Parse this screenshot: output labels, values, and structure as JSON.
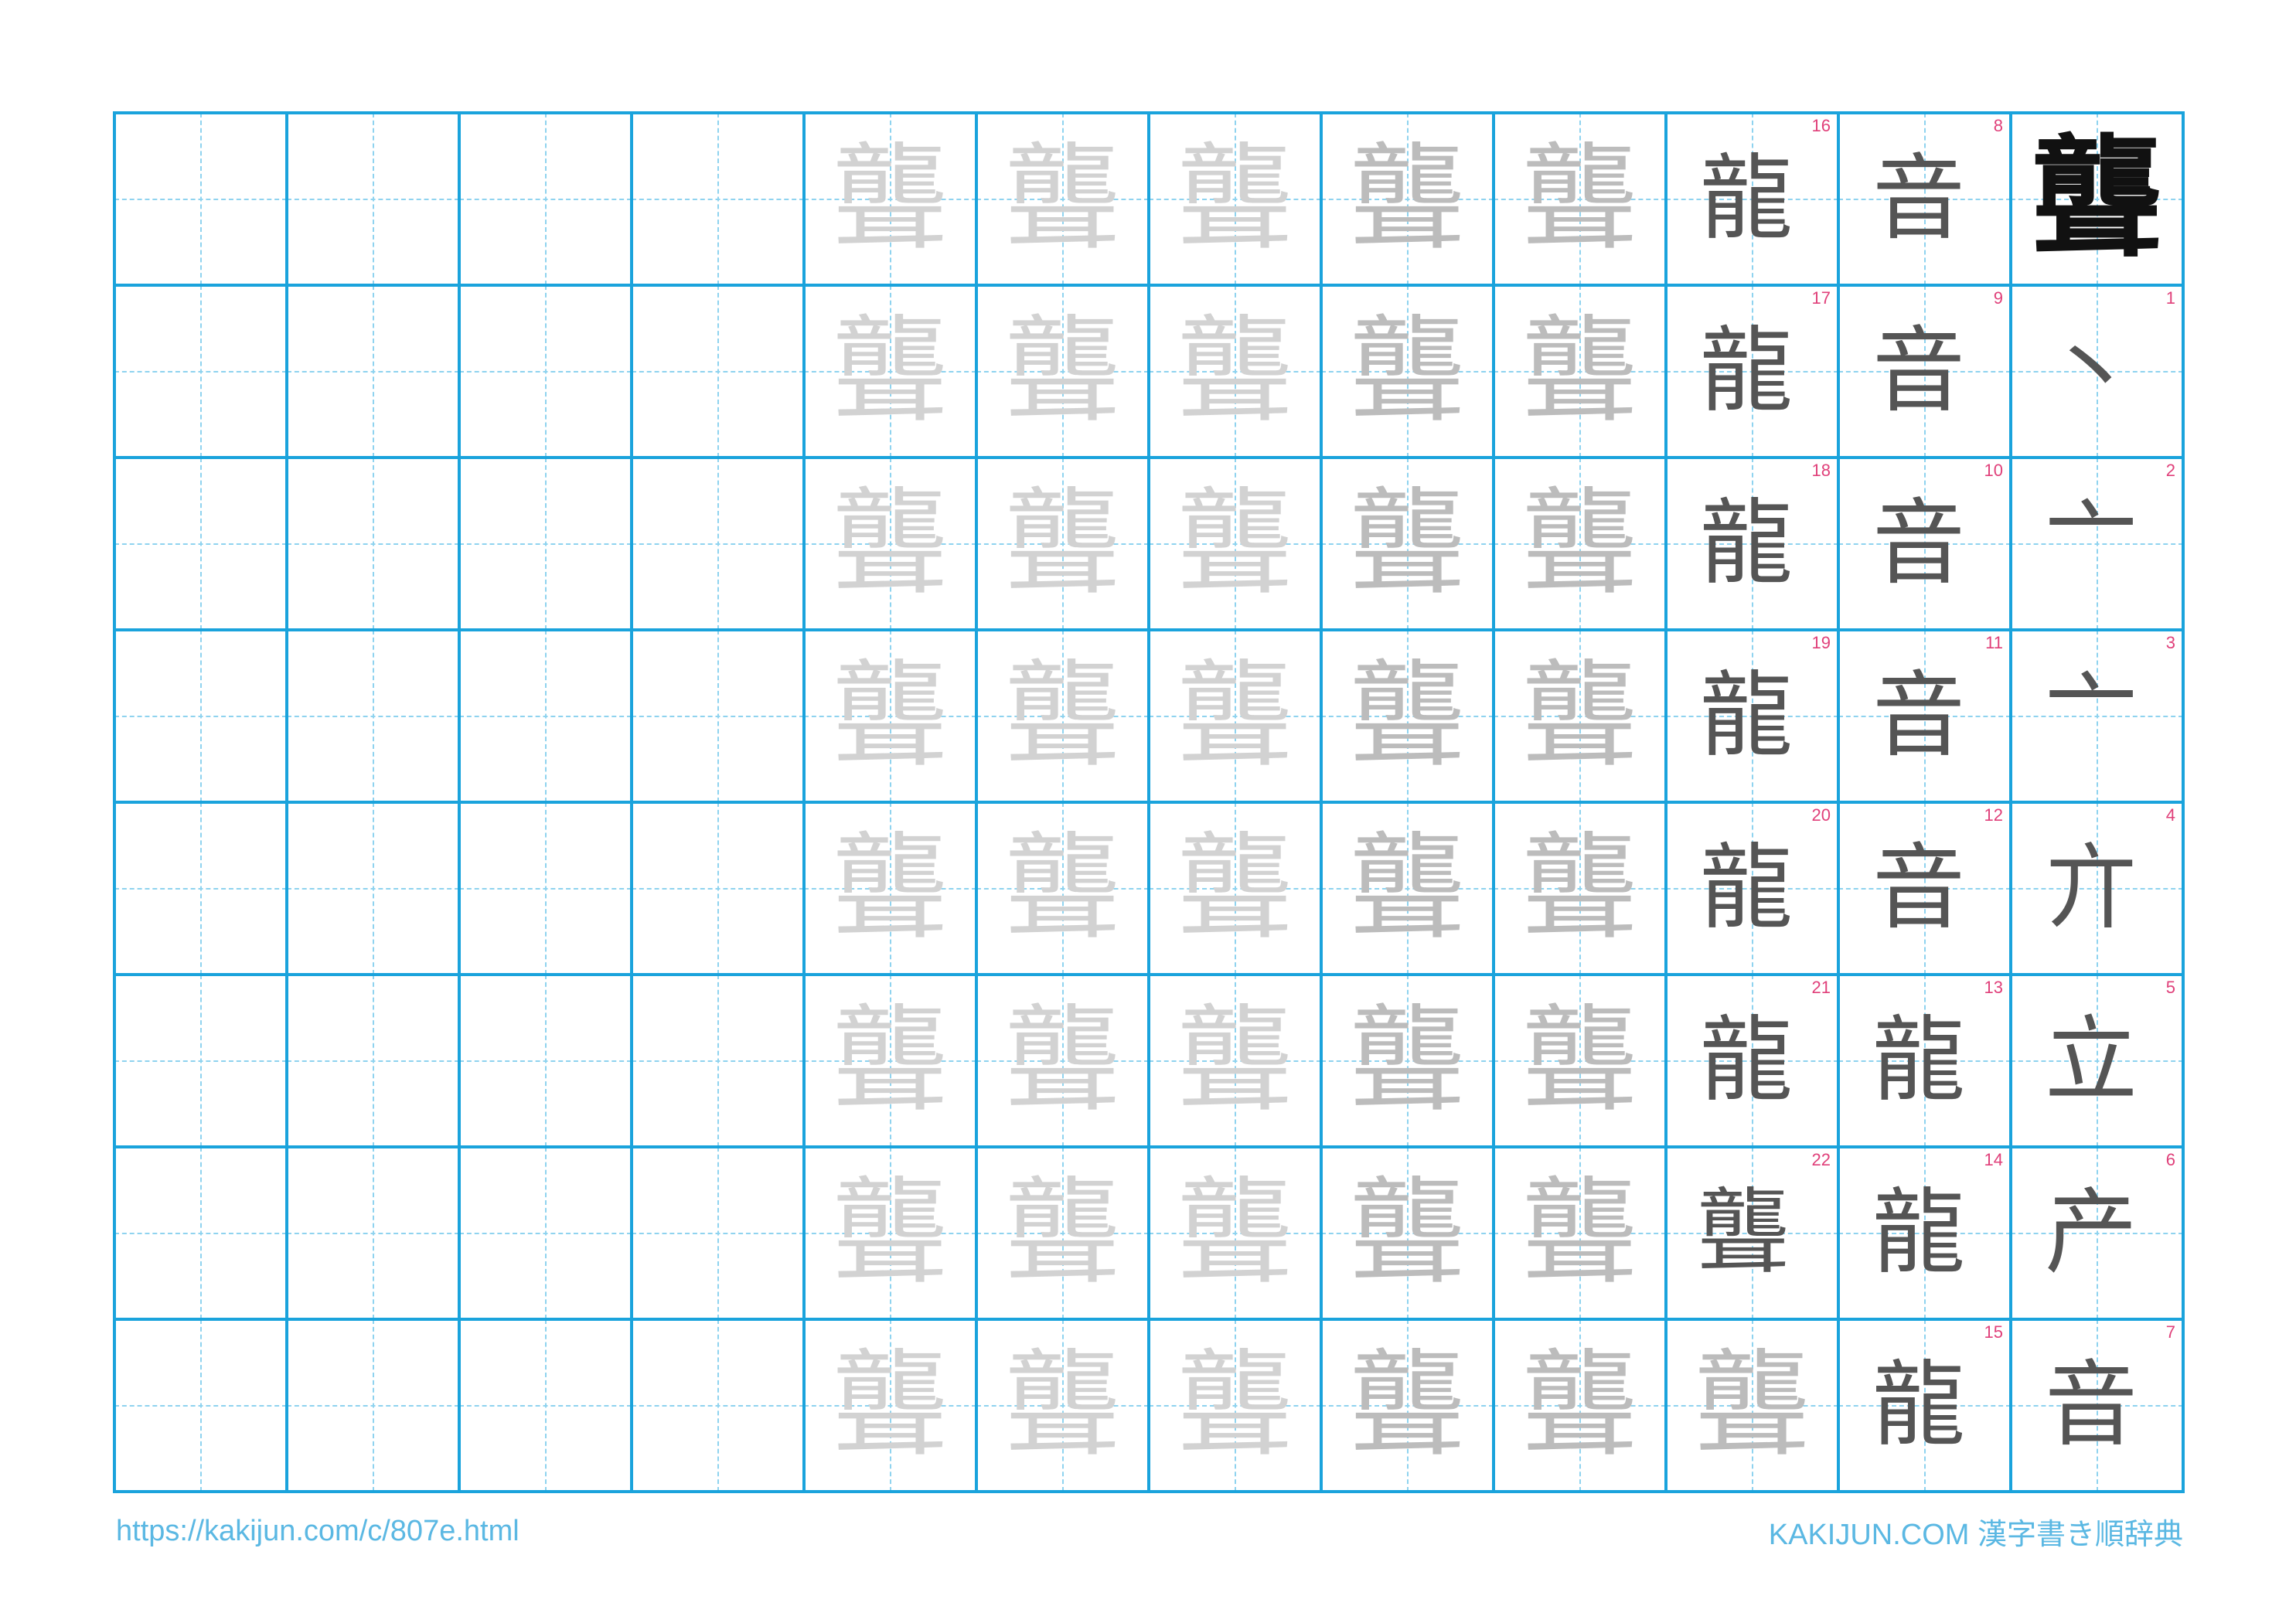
{
  "worksheet": {
    "kanji": "聾",
    "stroke_order": [
      {
        "n": "1",
        "g": "丶"
      },
      {
        "n": "2",
        "g": "亠"
      },
      {
        "n": "3",
        "g": "亠"
      },
      {
        "n": "4",
        "g": "亣"
      },
      {
        "n": "5",
        "g": "立"
      },
      {
        "n": "6",
        "g": "产"
      },
      {
        "n": "7",
        "g": "音"
      },
      {
        "n": "8",
        "g": "音"
      },
      {
        "n": "9",
        "g": "音"
      },
      {
        "n": "10",
        "g": "音"
      },
      {
        "n": "11",
        "g": "音"
      },
      {
        "n": "12",
        "g": "音"
      },
      {
        "n": "13",
        "g": "龍"
      },
      {
        "n": "14",
        "g": "龍"
      },
      {
        "n": "15",
        "g": "龍"
      },
      {
        "n": "16",
        "g": "龍"
      },
      {
        "n": "17",
        "g": "龍"
      },
      {
        "n": "18",
        "g": "龍"
      },
      {
        "n": "19",
        "g": "龍"
      },
      {
        "n": "20",
        "g": "龍"
      },
      {
        "n": "21",
        "g": "龍"
      },
      {
        "n": "22",
        "g": "聾"
      }
    ],
    "trace_glyph": "聾",
    "grid": {
      "columns": 12,
      "rows": 8
    },
    "colors": {
      "grid": "#1aa3dc",
      "guide": "#8fd3ef",
      "stroke_number": "#e0407a",
      "footer_text": "#5bb8e3"
    }
  },
  "footer": {
    "url": "https://kakijun.com/c/807e.html",
    "brand": "KAKIJUN.COM 漢字書き順辞典"
  }
}
